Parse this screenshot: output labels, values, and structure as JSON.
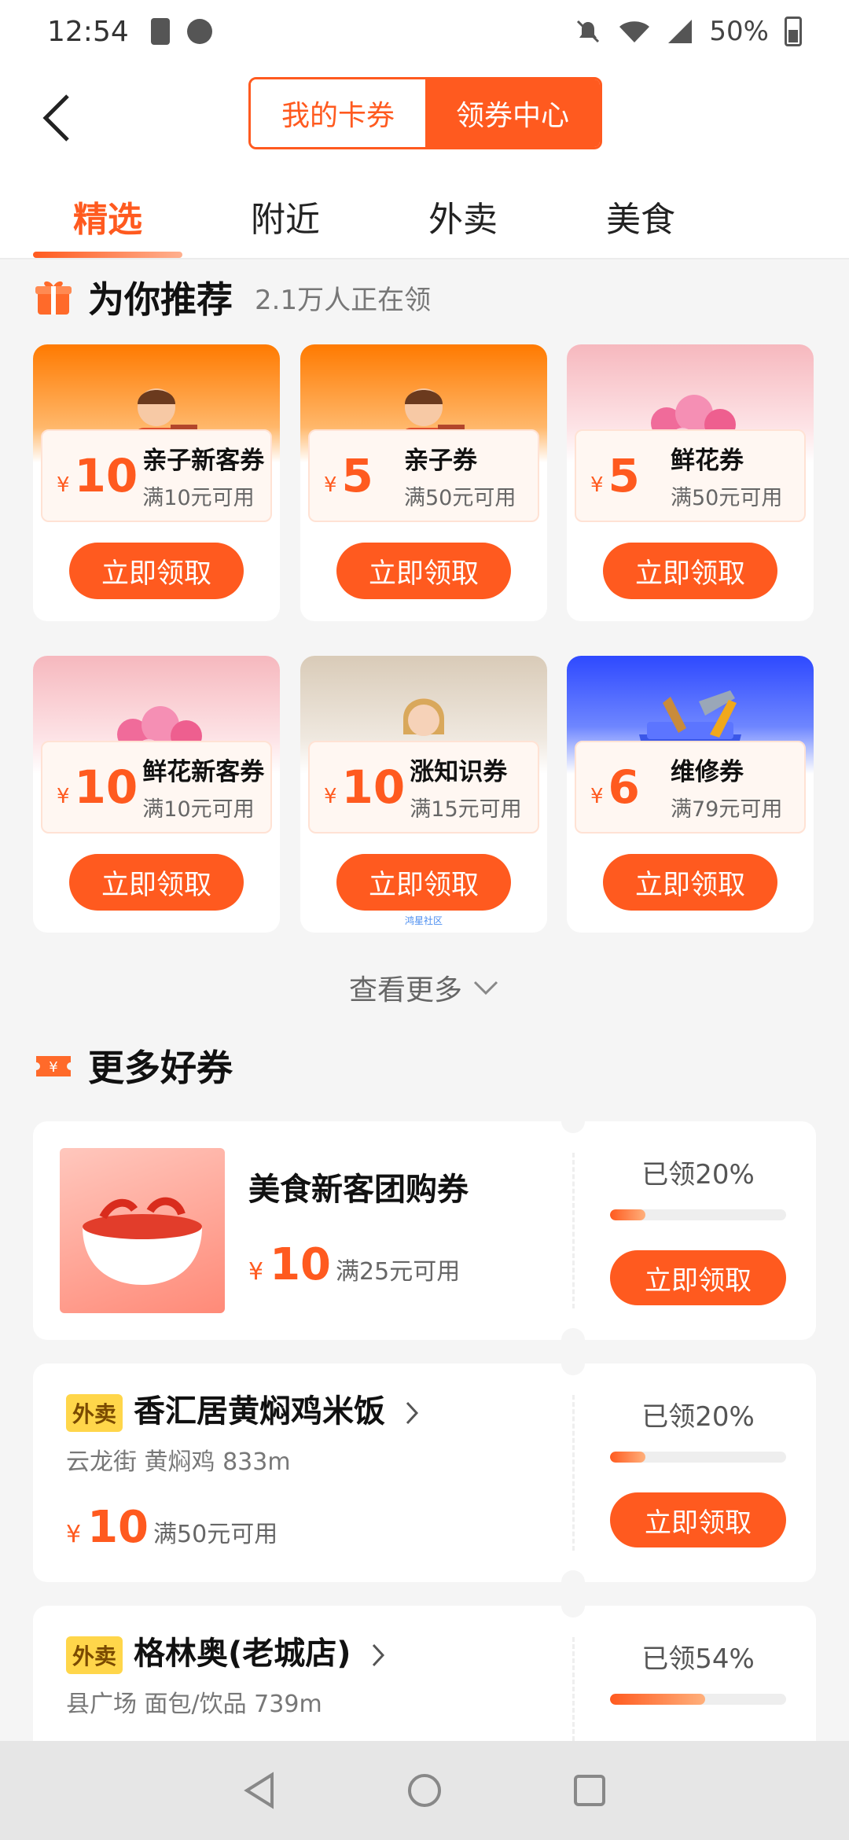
{
  "status": {
    "time": "12:54",
    "battery_pct": "50%"
  },
  "header": {
    "segment": [
      "我的卡券",
      "领券中心"
    ],
    "tabs": [
      "精选",
      "附近",
      "外卖",
      "美食"
    ]
  },
  "recommend": {
    "title": "为你推荐",
    "subtitle": "2.1万人正在领",
    "cards": [
      {
        "amount": "10",
        "title": "亲子新客券",
        "cond": "满10元可用",
        "button": "立即领取",
        "banner": "child"
      },
      {
        "amount": "5",
        "title": "亲子券",
        "cond": "满50元可用",
        "button": "立即领取",
        "banner": "child"
      },
      {
        "amount": "5",
        "title": "鲜花券",
        "cond": "满50元可用",
        "button": "立即领取",
        "banner": "flower"
      },
      {
        "amount": "10",
        "title": "鲜花新客券",
        "cond": "满10元可用",
        "button": "立即领取",
        "banner": "flower"
      },
      {
        "amount": "10",
        "title": "涨知识券",
        "cond": "满15元可用",
        "button": "立即领取",
        "banner": "knowledge"
      },
      {
        "amount": "6",
        "title": "维修券",
        "cond": "满79元可用",
        "button": "立即领取",
        "banner": "repair"
      }
    ],
    "currency": "¥",
    "watermark": "鸿星社区",
    "more_label": "查看更多"
  },
  "more_coupons": {
    "title": "更多好券",
    "items": [
      {
        "title": "美食新客团购券",
        "amount": "10",
        "cond": "满25元可用",
        "claimed": "已领20%",
        "claimed_fraction": 0.2,
        "button": "立即领取"
      },
      {
        "tag": "外卖",
        "title": "香汇居黄焖鸡米饭",
        "meta": "云龙街 黄焖鸡 833m",
        "amount": "10",
        "cond": "满50元可用",
        "claimed": "已领20%",
        "claimed_fraction": 0.2,
        "button": "立即领取"
      },
      {
        "tag": "外卖",
        "title": "格林奥(老城店)",
        "meta": "县广场 面包/饮品 739m",
        "claimed": "已领54%",
        "claimed_fraction": 0.54
      }
    ]
  }
}
